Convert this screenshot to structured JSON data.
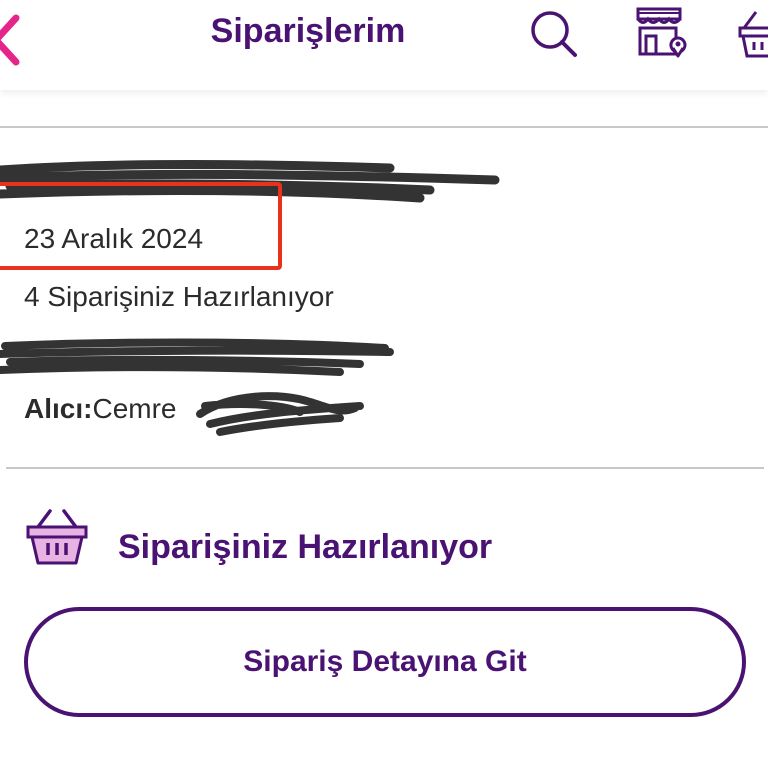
{
  "header": {
    "title": "Siparişlerim",
    "icons": [
      "back-chevron-icon",
      "search-icon",
      "store-location-icon",
      "basket-icon"
    ],
    "accent_color": "#4a1272",
    "back_color": "#e6258a"
  },
  "order": {
    "date": "23 Aralık 2024",
    "status_line": "4 Siparişiniz Hazırlanıyor",
    "recipient_label": "Alıcı:",
    "recipient_name": "Cemre"
  },
  "status": {
    "icon": "basket-icon",
    "label": "Siparişiniz Hazırlanıyor"
  },
  "actions": {
    "detail_button": "Sipariş Detayına Git"
  }
}
